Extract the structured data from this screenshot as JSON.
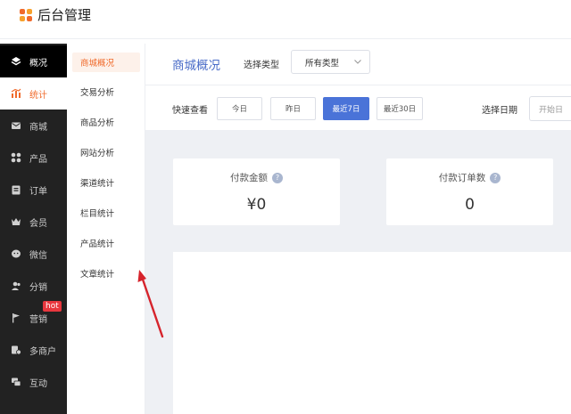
{
  "app": {
    "title": "后台管理"
  },
  "sidebar": {
    "items": [
      {
        "label": "概况",
        "icon": "layers-icon"
      },
      {
        "label": "统计",
        "icon": "chart-icon"
      },
      {
        "label": "商城",
        "icon": "mail-icon"
      },
      {
        "label": "产品",
        "icon": "grid-icon"
      },
      {
        "label": "订单",
        "icon": "clipboard-icon"
      },
      {
        "label": "会员",
        "icon": "crown-icon"
      },
      {
        "label": "微信",
        "icon": "wechat-icon"
      },
      {
        "label": "分销",
        "icon": "users-icon"
      },
      {
        "label": "营销",
        "icon": "flag-icon",
        "badge": "hot"
      },
      {
        "label": "多商户",
        "icon": "store-icon"
      },
      {
        "label": "互动",
        "icon": "chat-icon"
      }
    ]
  },
  "submenu": {
    "items": [
      {
        "label": "商城概况"
      },
      {
        "label": "交易分析"
      },
      {
        "label": "商品分析"
      },
      {
        "label": "网站分析"
      },
      {
        "label": "渠道统计"
      },
      {
        "label": "栏目统计"
      },
      {
        "label": "产品统计"
      },
      {
        "label": "文章统计"
      }
    ]
  },
  "header": {
    "title": "商城概况",
    "type_label": "选择类型",
    "type_value": "所有类型"
  },
  "quick": {
    "label": "快速查看",
    "buttons": [
      "今日",
      "昨日",
      "最近7日",
      "最近30日"
    ],
    "active_index": 2,
    "date_label": "选择日期",
    "date_placeholder": "开始日"
  },
  "cards": [
    {
      "title": "付款金额",
      "value": "¥0"
    },
    {
      "title": "付款订单数",
      "value": "0"
    }
  ],
  "colors": {
    "accent_orange": "#f06a2b",
    "accent_blue": "#4a73d8",
    "sidebar_bg": "#222222",
    "badge_red": "#e8373e",
    "arrow_red": "#d6242c"
  }
}
